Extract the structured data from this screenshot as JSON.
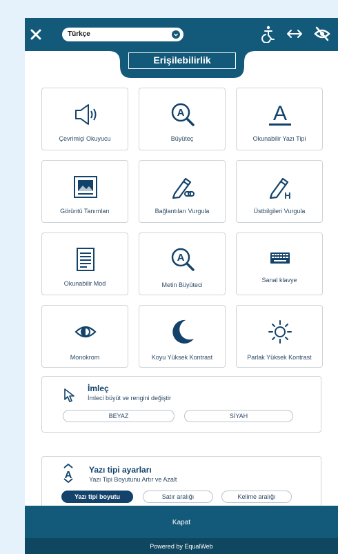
{
  "header": {
    "language": "Türkçe",
    "title": "Erişilebilirlik",
    "icons": [
      "close-icon",
      "accessibility-person-icon",
      "resize-horizontal-icon",
      "hide-eye-icon"
    ]
  },
  "tiles": [
    {
      "label": "Çevrimiçi Okuyucu",
      "icon": "speaker-icon"
    },
    {
      "label": "Büyüteç",
      "icon": "magnifier-a-icon"
    },
    {
      "label": "Okunabilir Yazı Tipi",
      "icon": "readable-font-icon"
    },
    {
      "label": "Görüntü Tanımları",
      "icon": "image-description-icon"
    },
    {
      "label": "Bağlantıları Vurgula",
      "icon": "highlight-links-icon"
    },
    {
      "label": "Üstbilgileri Vurgula",
      "icon": "highlight-headers-icon"
    },
    {
      "label": "Okunabilir Mod",
      "icon": "readable-mode-icon"
    },
    {
      "label": "Metin Büyüteci",
      "icon": "text-magnifier-icon"
    },
    {
      "label": "Sanal klavye",
      "icon": "keyboard-icon"
    },
    {
      "label": "Monokrom",
      "icon": "monochrome-eye-icon"
    },
    {
      "label": "Koyu Yüksek Kontrast",
      "icon": "moon-icon"
    },
    {
      "label": "Parlak Yüksek Kontrast",
      "icon": "sun-icon"
    }
  ],
  "cursor": {
    "title": "İmleç",
    "subtitle": "İmleci büyüt ve rengini değiştir",
    "options": [
      "BEYAZ",
      "SİYAH"
    ]
  },
  "font_settings": {
    "title": "Yazı tipi ayarları",
    "subtitle": "Yazı Tipi Boyutunu Artır ve Azalt",
    "tabs": [
      "Yazı tipi boyutu",
      "Satır aralığı",
      "Kelime aralığı"
    ],
    "active_tab": "Yazı tipi boyutu"
  },
  "footer": {
    "close_label": "Kapat",
    "powered_by": "Powered by EqualWeb"
  },
  "colors": {
    "primary": "#13597a",
    "dark": "#13426a",
    "background": "#e6f2fb"
  }
}
